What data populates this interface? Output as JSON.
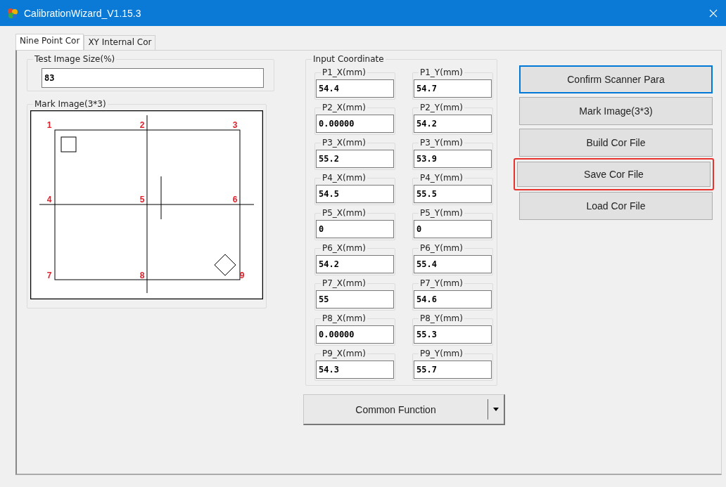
{
  "window": {
    "title": "CalibrationWizard_V1.15.3"
  },
  "tabs": [
    {
      "label": "Nine Point Cor",
      "selected": true
    },
    {
      "label": "XY Internal Cor",
      "selected": false
    }
  ],
  "test_image_size": {
    "label": "Test Image Size(%)",
    "value": "83"
  },
  "mark_image": {
    "title": "Mark Image(3*3)",
    "point_labels": [
      "1",
      "2",
      "3",
      "4",
      "5",
      "6",
      "7",
      "8",
      "9"
    ]
  },
  "input_coordinate": {
    "title": "Input Coordinate",
    "fields": [
      {
        "label": "P1_X(mm)",
        "value": "54.4"
      },
      {
        "label": "P1_Y(mm)",
        "value": "54.7"
      },
      {
        "label": "P2_X(mm)",
        "value": "0.00000"
      },
      {
        "label": "P2_Y(mm)",
        "value": "54.2"
      },
      {
        "label": "P3_X(mm)",
        "value": "55.2"
      },
      {
        "label": "P3_Y(mm)",
        "value": "53.9"
      },
      {
        "label": "P4_X(mm)",
        "value": "54.5"
      },
      {
        "label": "P4_Y(mm)",
        "value": "55.5"
      },
      {
        "label": "P5_X(mm)",
        "value": "0"
      },
      {
        "label": "P5_Y(mm)",
        "value": "0"
      },
      {
        "label": "P6_X(mm)",
        "value": "54.2"
      },
      {
        "label": "P6_Y(mm)",
        "value": "55.4"
      },
      {
        "label": "P7_X(mm)",
        "value": "55"
      },
      {
        "label": "P7_Y(mm)",
        "value": "54.6"
      },
      {
        "label": "P8_X(mm)",
        "value": "0.00000"
      },
      {
        "label": "P8_Y(mm)",
        "value": "55.3"
      },
      {
        "label": "P9_X(mm)",
        "value": "54.3"
      },
      {
        "label": "P9_Y(mm)",
        "value": "55.7"
      }
    ]
  },
  "buttons": [
    {
      "label": "Confirm Scanner Para",
      "focused": true,
      "highlighted": false
    },
    {
      "label": "Mark Image(3*3)",
      "focused": false,
      "highlighted": false
    },
    {
      "label": "Build Cor File",
      "focused": false,
      "highlighted": false
    },
    {
      "label": "Save Cor File",
      "focused": false,
      "highlighted": true
    },
    {
      "label": "Load Cor File",
      "focused": false,
      "highlighted": false
    }
  ],
  "common_function": {
    "label": "Common Function"
  }
}
